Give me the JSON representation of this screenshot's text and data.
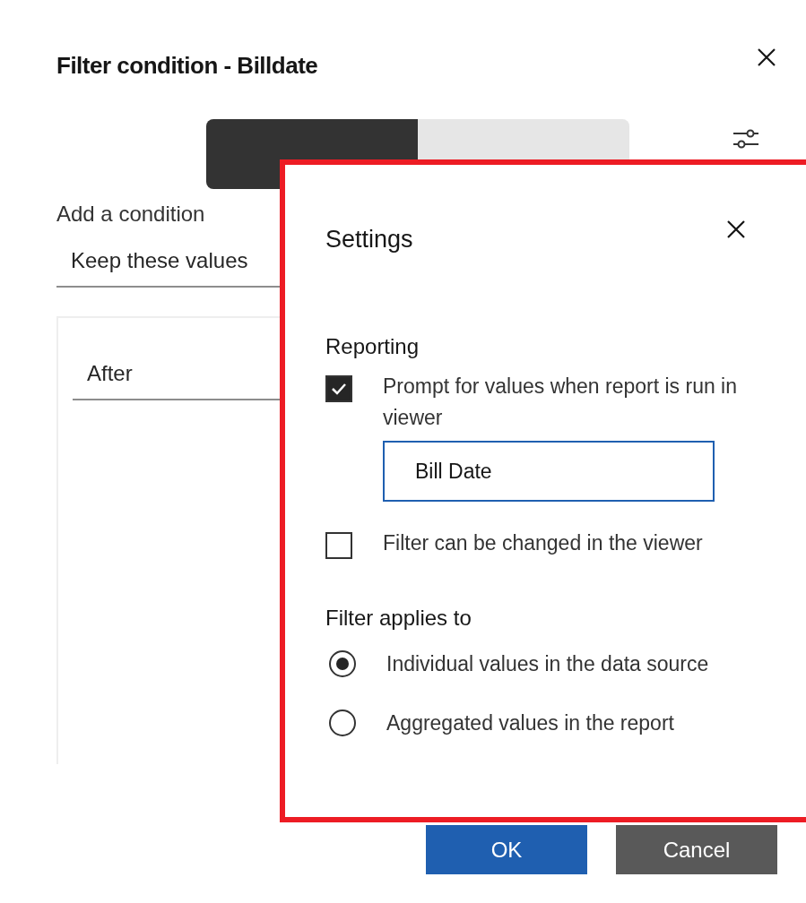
{
  "dialog": {
    "title": "Filter condition - Billdate",
    "tabs": [
      {
        "selected": true
      },
      {
        "selected": false
      }
    ],
    "condition_label": "Add a condition",
    "condition_select": {
      "value": "Keep these values"
    },
    "operator_select": {
      "value": "After"
    },
    "buttons": [
      {
        "label": "OK",
        "kind": "primary"
      },
      {
        "label": "Cancel",
        "kind": "secondary"
      }
    ]
  },
  "settings": {
    "title": "Settings",
    "reporting_heading": "Reporting",
    "options": [
      {
        "label": "Prompt for values when report is run in viewer",
        "checked": true,
        "field_value": "Bill Date"
      },
      {
        "label": "Filter can be changed in the viewer",
        "checked": false
      }
    ],
    "applies_heading": "Filter applies to",
    "applies": [
      {
        "label": "Individual values in the data source",
        "selected": true
      },
      {
        "label": "Aggregated values in the report",
        "selected": false
      }
    ]
  }
}
